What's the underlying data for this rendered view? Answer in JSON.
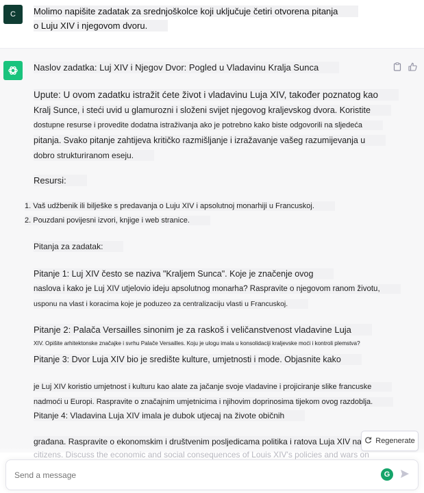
{
  "user": {
    "avatar": "C",
    "lines": [
      "Molimo napišite zadatak za srednjoškolce koji uključuje četiri otvorena pitanja",
      "o Luju XIV i njegovom dvoru."
    ]
  },
  "assistant": {
    "title": "Naslov zadatka: Luj XIV i Njegov Dvor: Pogled u Vladavinu Kralja Sunca",
    "instructions": [
      "Upute: U ovom zadatku istražit ćete život i vladavinu Luja XIV, također poznatog kao",
      "Kralj Sunce, i steći uvid u glamurozni i složeni svijet njegovog kraljevskog dvora. Koristite",
      "dostupne resurse i provedite dodatna istraživanja ako je potrebno kako biste odgovorili na sljedeća",
      "pitanja. Svako pitanje zahtijeva kritičko razmišljanje i izražavanje vašeg razumijevanja u",
      "dobro strukturiranom eseju."
    ],
    "resources_heading": "Resursi:",
    "resources": [
      "1. Vaš udžbenik ili bilješke s predavanja o Luju XIV i apsolutnoj monarhiji u Francuskoj.",
      "2. Pouzdani povijesni izvori, knjige i web stranice."
    ],
    "questions_heading": "Pitanja za zadatak:",
    "q1": [
      "Pitanje 1: Luj XIV često se naziva \"Kraljem Sunca\". Koje je značenje ovog",
      "naslova i kako je Luj XIV utjelovio ideju apsolutnog monarha? Raspravite o njegovom ranom životu,",
      "usponu na vlast i koracima koje je poduzeo za centralizaciju vlasti u Francuskoj."
    ],
    "q2": [
      "Pitanje 2: Palača Versailles sinonim je za raskoš i veličanstvenost vladavine Luja",
      "XIV. Opišite arhitektonske značajke i svrhu Palače Versailles. Koju je ulogu imala u konsolidaciji kraljevske moći i kontroli plemstva?"
    ],
    "q3": [
      "Pitanje 3: Dvor Luja XIV bio je središte kulture, umjetnosti i mode. Objasnite kako",
      "je Luj XIV koristio umjetnost i kulturu kao alate za jačanje svoje vladavine i projiciranje slike francuske",
      "nadmoći u Europi. Raspravite o značajnim umjetnicima i njihovim doprinosima tijekom ovog razdoblja."
    ],
    "q4": [
      "Pitanje 4: Vladavina Luja XIV imala je dubok utjecaj na živote običnih",
      "građana. Raspravite o ekonomskim i društvenim posljedicama politika i ratova Luja XIV na",
      "citizens. Discuss the economic and social consequences of Louis XIV's policies and wars on"
    ]
  },
  "regenerate_label": "Regenerate",
  "input": {
    "placeholder": "Send a message"
  },
  "icons": {
    "user_avatar": "user-avatar",
    "assistant_logo": "openai-logo-icon",
    "copy": "clipboard-icon",
    "like": "thumbs-up-icon",
    "regenerate": "refresh-icon",
    "grammarly": "grammarly-icon",
    "send": "send-icon"
  },
  "colors": {
    "assistant_bg": "#f7f7f8",
    "gpt_green": "#19c37d",
    "user_avatar_bg": "#0f3d33"
  }
}
